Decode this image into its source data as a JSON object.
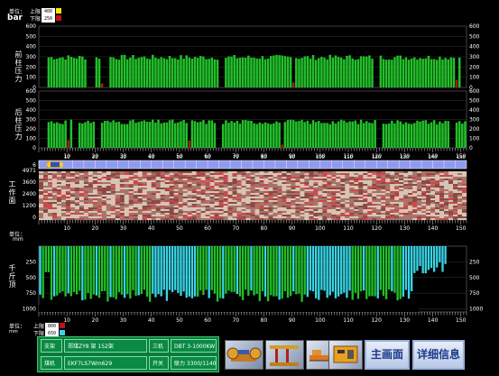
{
  "top_legend": {
    "unit_label": "单位：",
    "unit_value": "bar",
    "upper_label": "上限",
    "upper_value": "400",
    "lower_label": "下限",
    "lower_value": "250"
  },
  "chart1": {
    "title": "前柱压力",
    "y_ticks": [
      "600",
      "500",
      "400",
      "300",
      "200",
      "100",
      "0"
    ]
  },
  "chart2": {
    "title": "后柱压力",
    "y_ticks": [
      "600",
      "500",
      "400",
      "300",
      "200",
      "100",
      "0"
    ]
  },
  "x_ticks": [
    "10",
    "20",
    "30",
    "40",
    "50",
    "60",
    "70",
    "80",
    "90",
    "100",
    "110",
    "120",
    "130",
    "140",
    "150"
  ],
  "shearer": {
    "left_label": "6",
    "right_label": "150",
    "tick_numbers": [
      "10",
      "20",
      "30",
      "40",
      "50",
      "60",
      "70",
      "80",
      "90",
      "100",
      "110",
      "120",
      "130",
      "140",
      "150"
    ]
  },
  "working_face": {
    "title": "工作面",
    "top_value": "4971",
    "y_ticks": [
      "3600",
      "2400",
      "1200",
      "0"
    ]
  },
  "middle_legend": {
    "unit_label": "单位：",
    "unit_value": "mm"
  },
  "chart3": {
    "title": "千斤顶",
    "y_ticks_left": [
      "250",
      "500",
      "750",
      "1000"
    ],
    "y_ticks_right": [
      "250",
      "500",
      "750",
      "1000"
    ]
  },
  "bottom_legend": {
    "unit_label": "单位：",
    "unit_value": "mm",
    "upper_label": "上限",
    "upper_value": "800",
    "lower_label": "下限",
    "lower_value": "650"
  },
  "info": {
    "row1": {
      "k1": "支架",
      "v1": "郑煤ZY8 架 152架",
      "k2": "三机",
      "v2": "DBT 3-1000KW"
    },
    "row2": {
      "k1": "煤机",
      "v1": "EKF7LS7Wm629",
      "k2": "开关",
      "v2": "联力 3300/1140"
    }
  },
  "buttons": {
    "main": "主画面",
    "detail": "详细信息"
  },
  "colors": {
    "green": "#22c02a",
    "red": "#b0181a",
    "cyan": "#38d6e6",
    "yellow": "#ffe800",
    "blue": "#8f9af0"
  },
  "chart_data": [
    {
      "type": "bar",
      "title": "前柱压力",
      "ylim": [
        0,
        600
      ],
      "note": "152 supports; typical 270–330 bar, few red below lower limit"
    },
    {
      "type": "bar",
      "title": "后柱压力",
      "ylim": [
        0,
        600
      ],
      "note": "152 supports; typical 250–330 bar"
    },
    {
      "type": "bar",
      "title": "千斤顶",
      "ylim": [
        0,
        1000
      ],
      "note": "jack stroke in mm, green/cyan bars"
    }
  ]
}
